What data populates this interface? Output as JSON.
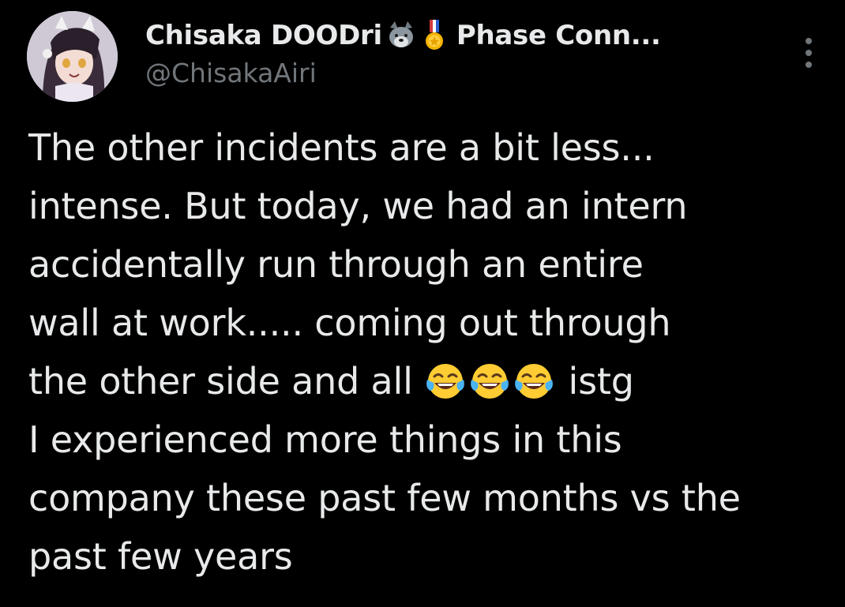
{
  "tweet": {
    "display_name": "Chisaka DOODri",
    "name_suffix": "Phase Conn...",
    "handle": "@ChisakaAiri",
    "badges": [
      "wolf-emoji",
      "medal-emoji"
    ],
    "more_icon": "more-vertical-icon",
    "body_lines": [
      "The other incidents are a bit less...",
      "intense. But today, we had an intern",
      "accidentally run through an entire",
      "wall at work..... coming out through",
      "the other side and all",
      "istg",
      "I experienced more things in this",
      "company these past few months vs the",
      "past few years"
    ],
    "inline_emojis": [
      "face-with-tears-of-joy",
      "face-with-tears-of-joy",
      "face-with-tears-of-joy"
    ]
  },
  "colors": {
    "background": "#000000",
    "text_primary": "#e7e9ea",
    "text_secondary": "#71767b"
  }
}
